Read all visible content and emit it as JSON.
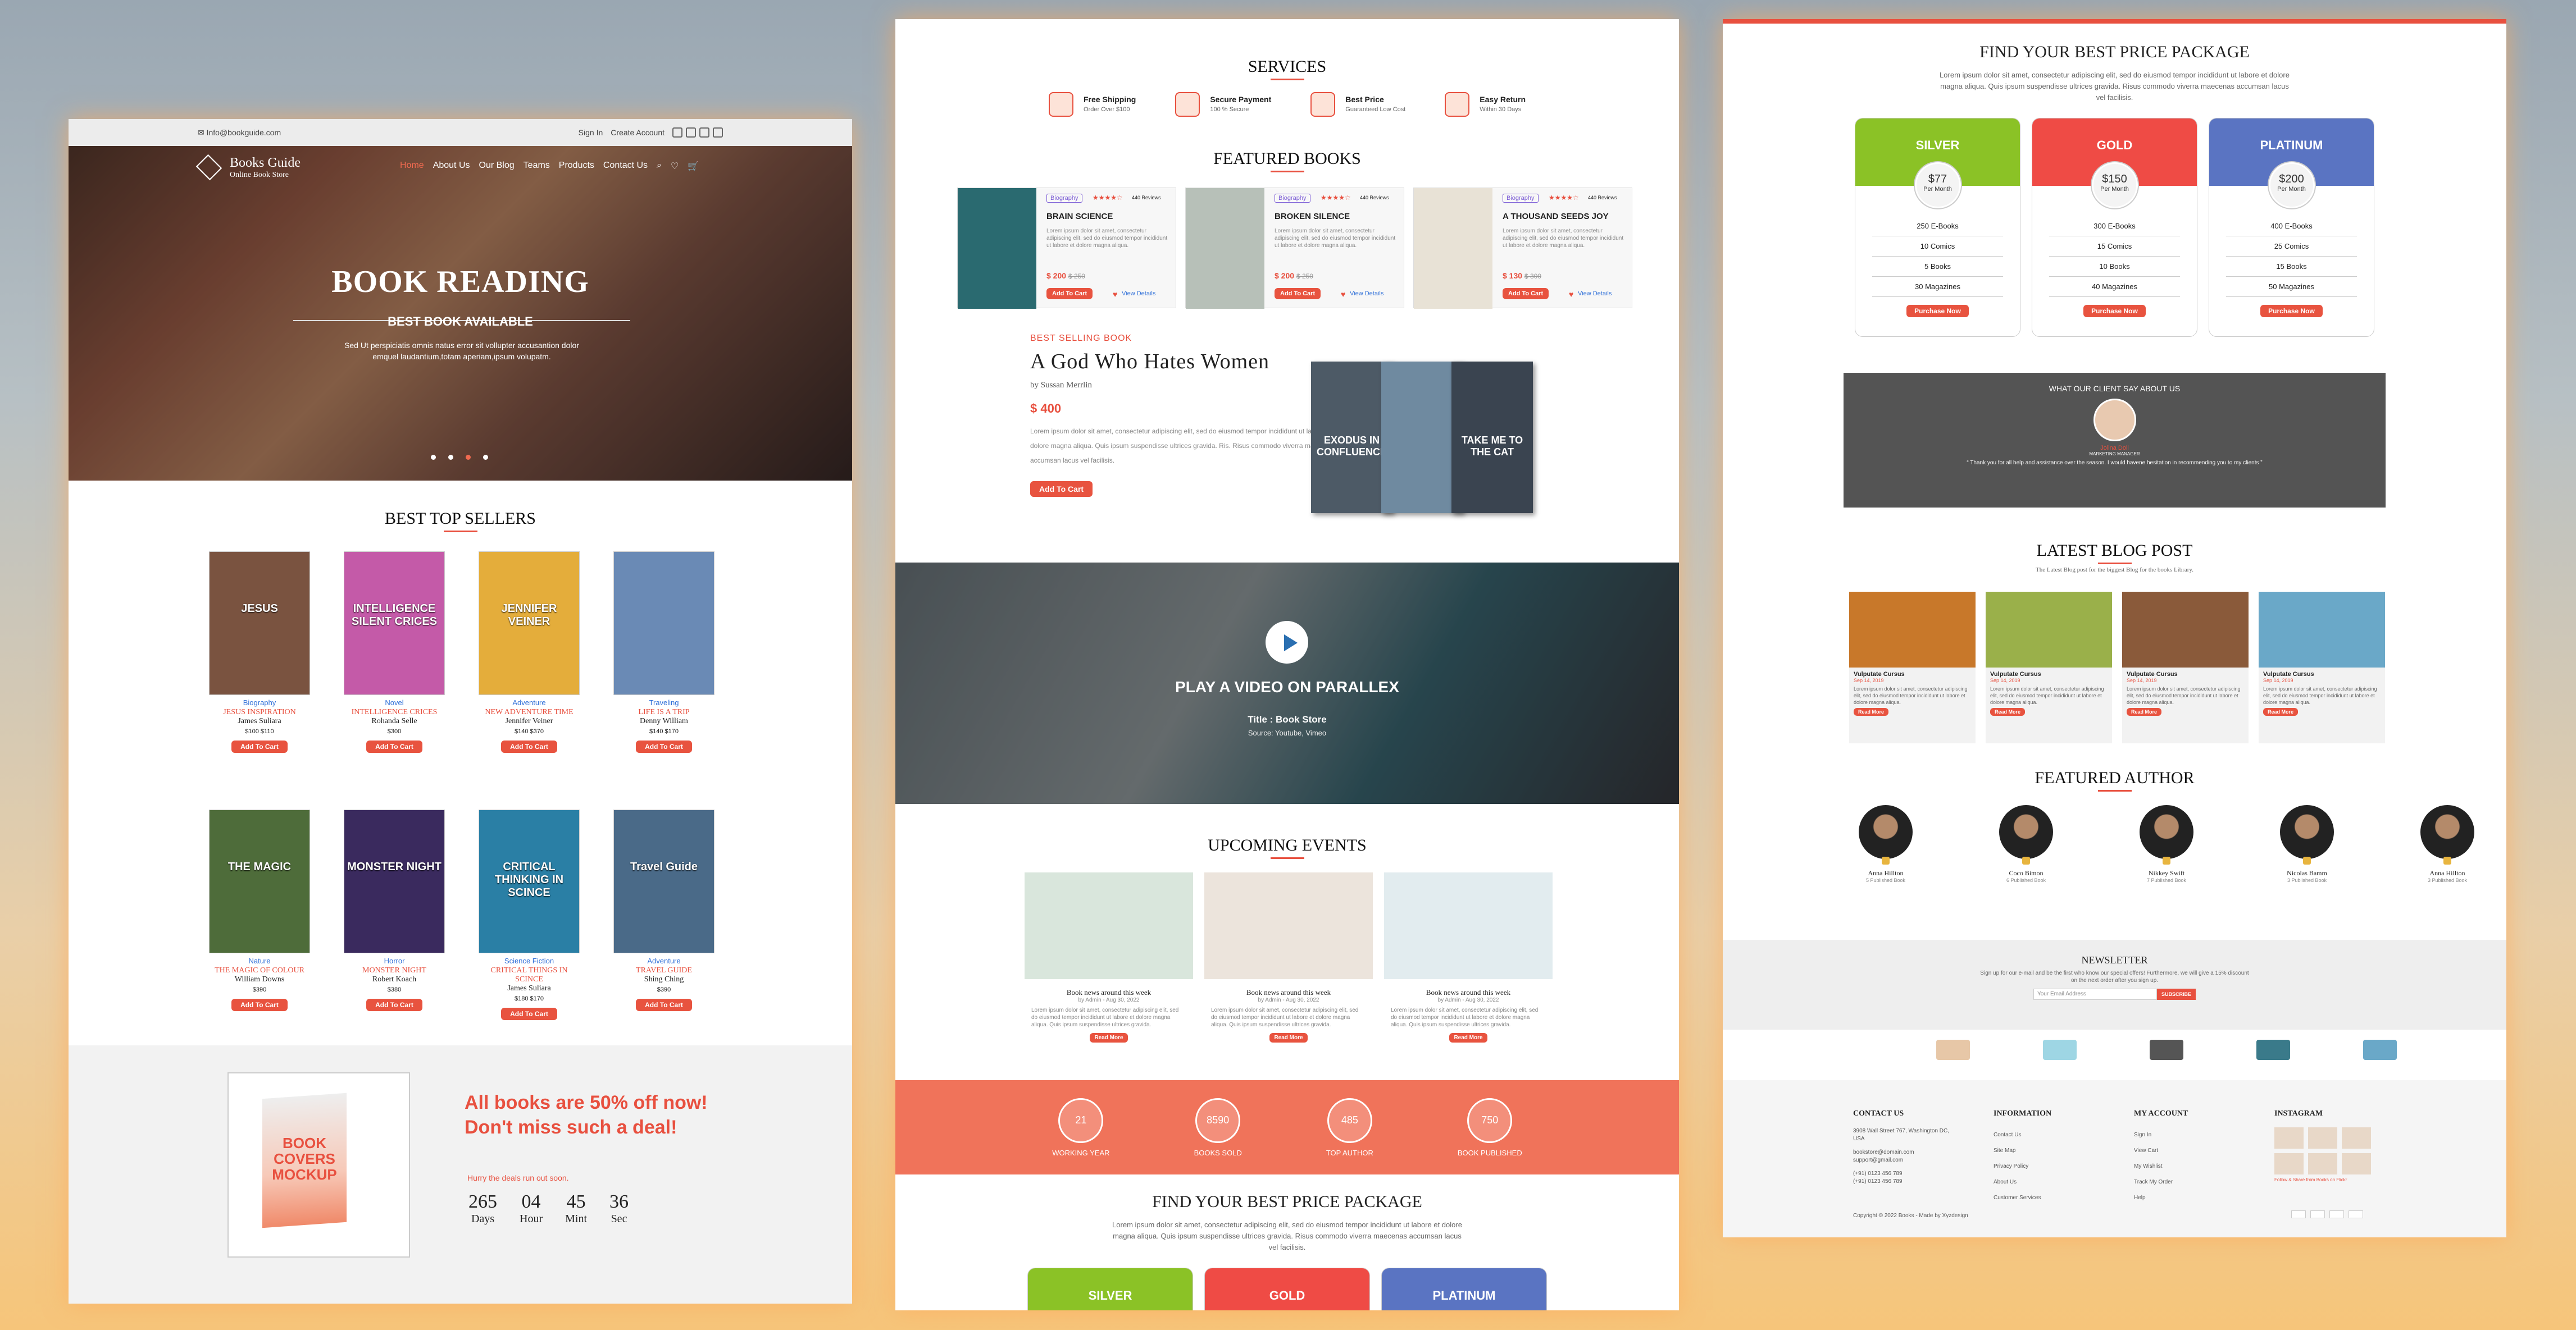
{
  "colors": {
    "accent": "#e8503f",
    "silver": "#8bc226",
    "gold": "#ef4b45",
    "platinum": "#5a74c2"
  },
  "panel1": {
    "topbar": {
      "email": "✉ Info@bookguide.com",
      "signin": "Sign In",
      "create": "Create Account"
    },
    "logo": {
      "name": "Books Guide",
      "tag": "Online Book Store"
    },
    "nav": [
      "Home",
      "About Us",
      "Our Blog",
      "Teams",
      "Products",
      "Contact Us"
    ],
    "hero": {
      "title": "BOOK READING",
      "subtitle": "BEST BOOK AVAILABLE",
      "text": "Sed Ut perspiciatis omnis natus error sit vollupter accusantion dolor emquel laudantium,totam aperiam,ipsum volupatm."
    },
    "best_title": "BEST TOP SELLERS",
    "books": [
      {
        "cover": "JESUS",
        "cat": "Biography",
        "title": "JESUS INSPIRATION",
        "author": "James Suliara",
        "price": "$100 $110",
        "btn": "Add To Cart",
        "bg": "#7a5340"
      },
      {
        "cover": "INTELLIGENCE SILENT CRICES",
        "cat": "Novel",
        "title": "INTELLIGENCE CRICES",
        "author": "Rohanda Selle",
        "price": "$300",
        "btn": "Add To Cart",
        "bg": "#c45aa8"
      },
      {
        "cover": "JENNIFER VEINER",
        "cat": "Adventure",
        "title": "NEW ADVENTURE TIME",
        "author": "Jennifer Veiner",
        "price": "$140 $370",
        "btn": "Add To Cart",
        "bg": "#e4ad3b"
      },
      {
        "cover": "",
        "cat": "Traveling",
        "title": "LIFE IS A TRIP",
        "author": "Denny William",
        "price": "$140 $170",
        "btn": "Add To Cart",
        "bg": "#6a8ab5"
      },
      {
        "cover": "THE MAGIC",
        "cat": "Nature",
        "title": "THE MAGIC OF COLOUR",
        "author": "William Downs",
        "price": "$390",
        "btn": "Add To Cart",
        "bg": "#4e6c3a"
      },
      {
        "cover": "MONSTER NIGHT",
        "cat": "Horror",
        "title": "MONSTER NIGHT",
        "author": "Robert Koach",
        "price": "$380",
        "btn": "Add To Cart",
        "bg": "#3a2a5e"
      },
      {
        "cover": "CRITICAL THINKING IN SCINCE",
        "cat": "Science Fiction",
        "title": "CRITICAL THINGS IN SCINCE",
        "author": "James Suliara",
        "price": "$180 $170",
        "btn": "Add To Cart",
        "bg": "#2a7fa5"
      },
      {
        "cover": "Travel Guide",
        "cat": "Adventure",
        "title": "TRAVEL GUIDE",
        "author": "Shing Ching",
        "price": "$390",
        "btn": "Add To Cart",
        "bg": "#4a6a88"
      }
    ],
    "promo": {
      "mock": "BOOK COVERS MOCKUP",
      "headline1": "All books are 50% off now!",
      "headline2": "Don't miss such a deal!",
      "hurry": "Hurry the deals run out soon.",
      "countdown": [
        {
          "v": "265",
          "l": "Days"
        },
        {
          "v": "04",
          "l": "Hour"
        },
        {
          "v": "45",
          "l": "Mint"
        },
        {
          "v": "36",
          "l": "Sec"
        }
      ]
    }
  },
  "panel2": {
    "services_title": "SERVICES",
    "services": [
      {
        "t": "Free Shipping",
        "s": "Order Over $100"
      },
      {
        "t": "Secure Payment",
        "s": "100 % Secure"
      },
      {
        "t": "Best Price",
        "s": "Guaranteed Low Cost"
      },
      {
        "t": "Easy Return",
        "s": "Within 30 Days"
      }
    ],
    "featured_title": "FEATURED BOOKS",
    "featured": [
      {
        "tag": "Biography",
        "stars": "★★★★☆",
        "rev": "440 Reviews",
        "title": "BRAIN SCIENCE",
        "desc": "Lorem ipsum dolor sit amet, consectetur adipiscing elit, sed do eiusmod tempor incididunt ut labore et dolore magna aliqua.",
        "price": "$ 200",
        "old": "$ 250",
        "btn": "Add To Cart",
        "view": "View Details",
        "bg": "#2a6a70"
      },
      {
        "tag": "Biography",
        "stars": "★★★★☆",
        "rev": "440 Reviews",
        "title": "BROKEN SILENCE",
        "desc": "Lorem ipsum dolor sit amet, consectetur adipiscing elit, sed do eiusmod tempor incididunt ut labore et dolore magna aliqua.",
        "price": "$ 200",
        "old": "$ 250",
        "btn": "Add To Cart",
        "view": "View Details",
        "bg": "#b7c0b8"
      },
      {
        "tag": "Biography",
        "stars": "★★★★☆",
        "rev": "440 Reviews",
        "title": "A THOUSAND SEEDS JOY",
        "desc": "Lorem ipsum dolor sit amet, consectetur adipiscing elit, sed do eiusmod tempor incididunt ut labore et dolore magna aliqua.",
        "price": "$ 130",
        "old": "$ 300",
        "btn": "Add To Cart",
        "view": "View Details",
        "bg": "#e8e2d6"
      }
    ],
    "best_label": "BEST SELLING BOOK",
    "best_title": "A God Who Hates Women",
    "best_by": "by Sussan Merrlin",
    "best_price": "$ 400",
    "best_desc": "Lorem ipsum dolor sit amet, consectetur adipiscing elit, sed do eiusmod tempor incididunt ut labore et dolore magna aliqua. Quis ipsum suspendisse ultrices gravida. Ris. Risus commodo viverra maecenas accumsan lacus vel facilisis.",
    "best_btn": "Add To Cart",
    "stack": [
      "EXODUS IN CONFLUENCE",
      "",
      "TAKE ME TO THE CAT"
    ],
    "video": {
      "title": "PLAY A VIDEO ON PARALLEX",
      "sub": "Title : Book Store",
      "src": "Source: Youtube, Vimeo"
    },
    "events_title": "UPCOMING EVENTS",
    "events": [
      {
        "t": "Book news around this week",
        "m": "by Admin - Aug 30, 2022",
        "d": "Lorem ipsum dolor sit amet, consectetur adipiscing elit, sed do eiusmod tempor incididunt ut labore et dolore magna aliqua. Quis ipsum suspendisse ultrices gravida.",
        "btn": "Read More",
        "bg": "#d9e6dc"
      },
      {
        "t": "Book news around this week",
        "m": "by Admin - Aug 30, 2022",
        "d": "Lorem ipsum dolor sit amet, consectetur adipiscing elit, sed do eiusmod tempor incididunt ut labore et dolore magna aliqua. Quis ipsum suspendisse ultrices gravida.",
        "btn": "Read More",
        "bg": "#ece4dc"
      },
      {
        "t": "Book news around this week",
        "m": "by Admin - Aug 30, 2022",
        "d": "Lorem ipsum dolor sit amet, consectetur adipiscing elit, sed do eiusmod tempor incididunt ut labore et dolore magna aliqua. Quis ipsum suspendisse ultrices gravida.",
        "btn": "Read More",
        "bg": "#e2ecef"
      }
    ],
    "stats": [
      {
        "v": "21",
        "l": "WORKING YEAR"
      },
      {
        "v": "8590",
        "l": "BOOKS SOLD"
      },
      {
        "v": "485",
        "l": "TOP AUTHOR"
      },
      {
        "v": "750",
        "l": "BOOK PUBLISHED"
      }
    ],
    "pkg_title": "FIND YOUR BEST PRICE PACKAGE",
    "pkg_sub": "Lorem ipsum dolor sit amet, consectetur adipiscing elit, sed do eiusmod tempor incididunt ut labore et dolore magna aliqua. Quis ipsum suspendisse ultrices gravida. Risus commodo viverra maecenas accumsan lacus vel facilisis.",
    "pkg_names": [
      "SILVER",
      "GOLD",
      "PLATINUM"
    ]
  },
  "panel3": {
    "pkg_title": "FIND YOUR BEST PRICE PACKAGE",
    "pkg_sub": "Lorem ipsum dolor sit amet, consectetur adipiscing elit, sed do eiusmod tempor incididunt ut labore et dolore magna aliqua. Quis ipsum suspendisse ultrices gravida. Risus commodo viverra maecenas accumsan lacus vel facilisis.",
    "packages": [
      {
        "name": "SILVER",
        "price": "$77",
        "per": "Per Month",
        "items": [
          "250 E-Books",
          "10 Comics",
          "5 Books",
          "30 Magazines"
        ],
        "btn": "Purchase Now"
      },
      {
        "name": "GOLD",
        "price": "$150",
        "per": "Per Month",
        "items": [
          "300 E-Books",
          "15 Comics",
          "10 Books",
          "40 Magazines"
        ],
        "btn": "Purchase Now"
      },
      {
        "name": "PLATINUM",
        "price": "$200",
        "per": "Per Month",
        "items": [
          "400 E-Books",
          "25 Comics",
          "15 Books",
          "50 Magazines"
        ],
        "btn": "Purchase Now"
      }
    ],
    "testi": {
      "h": "WHAT OUR CLIENT SAY ABOUT US",
      "name": "Jolina Doll",
      "role": "MARKETING MANAGER",
      "quote": "“ Thank you for all help and assistance over the season. I would havene hesitation in recommending you to my clients ”"
    },
    "blog_title": "LATEST BLOG POST",
    "blog_sub": "The Latest Blog post for the biggest Blog for the books Library.",
    "posts": [
      {
        "t": "Vulputate Cursus",
        "d": "Sep 14, 2019",
        "p": "Lorem ipsum dolor sit amet, consectetur adipiscing elit, sed do eiusmod tempor incididunt ut labore et dolore magna aliqua.",
        "btn": "Read More",
        "bg": "#c8782a"
      },
      {
        "t": "Vulputate Cursus",
        "d": "Sep 14, 2019",
        "p": "Lorem ipsum dolor sit amet, consectetur adipiscing elit, sed do eiusmod tempor incididunt ut labore et dolore magna aliqua.",
        "btn": "Read More",
        "bg": "#9ab04a"
      },
      {
        "t": "Vulputate Cursus",
        "d": "Sep 14, 2019",
        "p": "Lorem ipsum dolor sit amet, consectetur adipiscing elit, sed do eiusmod tempor incididunt ut labore et dolore magna aliqua.",
        "btn": "Read More",
        "bg": "#8a5a3a"
      },
      {
        "t": "Vulputate Cursus",
        "d": "Sep 14, 2019",
        "p": "Lorem ipsum dolor sit amet, consectetur adipiscing elit, sed do eiusmod tempor incididunt ut labore et dolore magna aliqua.",
        "btn": "Read More",
        "bg": "#6aa8c8"
      }
    ],
    "author_title": "FEATURED AUTHOR",
    "authors": [
      {
        "n": "Anna Hillton",
        "p": "5 Published Book"
      },
      {
        "n": "Coco Bimon",
        "p": "6 Published Book"
      },
      {
        "n": "Nikkey Swift",
        "p": "7 Published Book"
      },
      {
        "n": "Nicolas Bamm",
        "p": "3 Published Book"
      },
      {
        "n": "Anna Hillton",
        "p": "3 Published Book"
      }
    ],
    "news": {
      "title": "NEWSLETTER",
      "text1": "Sign up for our e-mail and be the first who know our special offers! Furthermore, we will give a 15% discount",
      "text2": "on the next order after you sign up.",
      "placeholder": "Your Email Address",
      "btn": "SUBSCRIBE"
    },
    "footer": {
      "contact_h": "CONTACT US",
      "addr": "3908 Wall Street 767, Washington DC, USA",
      "mail1": "bookstore@domain.com",
      "mail2": "support@gmail.com",
      "ph1": "(+91) 0123 456 789",
      "ph2": "(+91) 0123 456 789",
      "info_h": "INFORMATION",
      "info": [
        "Contact Us",
        "Site Map",
        "Privacy Policy",
        "About Us",
        "Customer Services"
      ],
      "acc_h": "MY ACCOUNT",
      "acc": [
        "Sign In",
        "View Cart",
        "My Wishlist",
        "Track My Order",
        "Help"
      ],
      "insta_h": "INSTAGRAM",
      "insta_note": "Follow & Share from Books on Flickr",
      "copy": "Copyright © 2022 Books - Made by Xyzdesign"
    }
  }
}
